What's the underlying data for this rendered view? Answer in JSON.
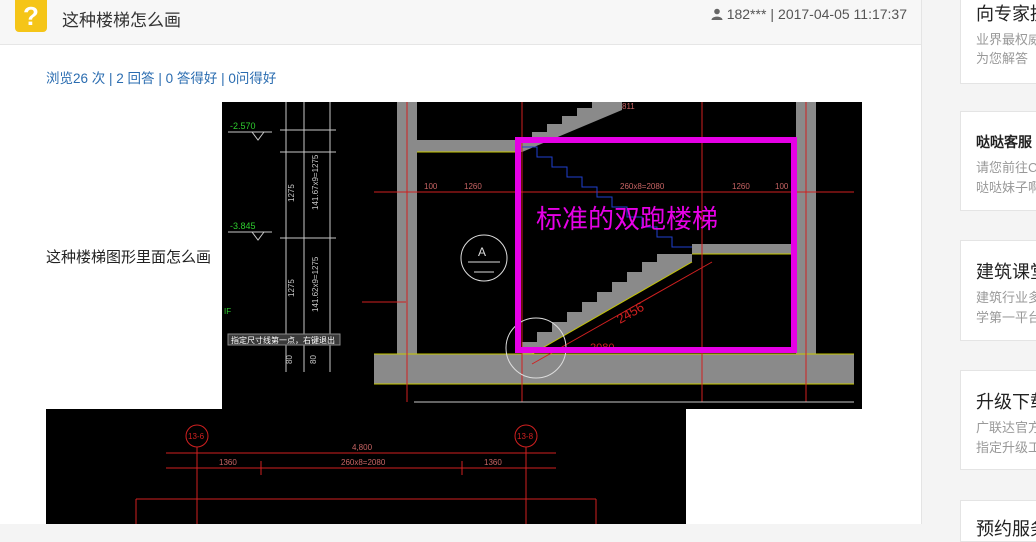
{
  "question": {
    "icon": "question-icon",
    "icon_glyph": "?",
    "title": "这种楼梯怎么画",
    "user": "182***",
    "separator": "|",
    "datetime": "2017-04-05 11:17:37"
  },
  "stats": {
    "views": "浏览26 次",
    "answers": "2 回答",
    "good_answers": "0 答得好",
    "good_questions": "0问得好",
    "sep": " | "
  },
  "body_text": "这种楼梯图形里面怎么画",
  "cad_image_1": {
    "annotation": "标准的双跑楼梯",
    "levels": [
      "-2.570",
      "-3.845"
    ],
    "dims_top": [
      "100",
      "1260",
      "260x8=2080",
      "1260",
      "100"
    ],
    "vert_dims": [
      "1275",
      "1275",
      "141.67x9=1275",
      "141.62x9=1275"
    ],
    "axis_label": "A",
    "slope_label": "2456",
    "run_label": "2080",
    "tooltip": "指定尺寸线第一点，右键退出",
    "other_small": [
      "80",
      "80",
      "IF",
      "811"
    ]
  },
  "cad_image_2": {
    "axes": [
      "13-6",
      "13-8"
    ],
    "total_dim": "4,800",
    "dims": [
      "1360",
      "260x8=2080",
      "1360"
    ]
  },
  "sidebar": {
    "cards": [
      {
        "title": "向专家提",
        "desc": [
          "业界最权威",
          "为您解答"
        ]
      },
      {
        "title": "哒哒客服",
        "desc": [
          "请您前往C",
          "哒哒妹子啊"
        ]
      },
      {
        "title": "建筑课堂",
        "desc": [
          "建筑行业多",
          "学第一平台"
        ]
      },
      {
        "title": "升级下载",
        "desc": [
          "广联达官方",
          "指定升级工"
        ]
      },
      {
        "title": "预约服务",
        "desc": []
      }
    ]
  },
  "colors": {
    "accent_link": "#2a6cb0",
    "question_icon": "#f5c518",
    "magenta": "#e600e6",
    "cad_yellow": "#c8c800",
    "cad_red": "#d02020",
    "cad_gray": "#8a8a8a"
  }
}
